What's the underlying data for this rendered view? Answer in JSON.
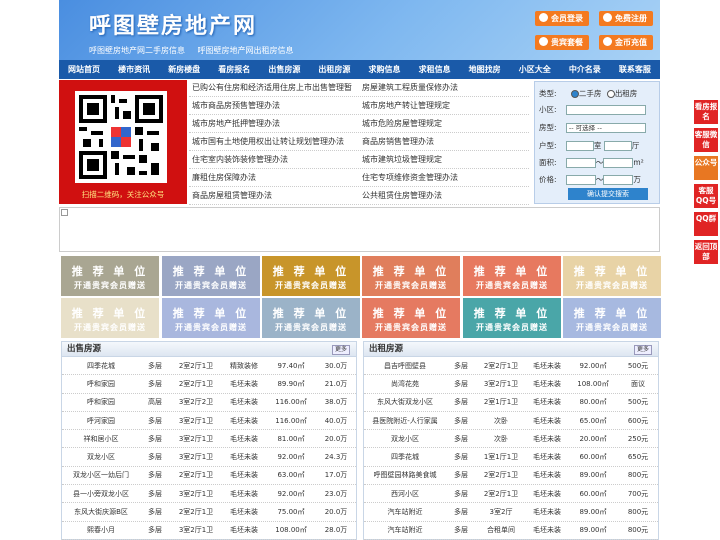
{
  "header": {
    "title": "呼图壁房地产网",
    "sub_links": [
      "呼图壁房地产网二手房信息",
      "呼图壁房地产网出租房信息"
    ],
    "buttons": [
      {
        "label": "会员登录"
      },
      {
        "label": "免费注册"
      },
      {
        "label": "贵宾套餐"
      },
      {
        "label": "金币充值"
      }
    ]
  },
  "nav": [
    "网站首页",
    "楼市资讯",
    "新房楼盘",
    "看房报名",
    "出售房源",
    "出租房源",
    "求购信息",
    "求租信息",
    "地图找房",
    "小区大全",
    "中介名录",
    "联系客服"
  ],
  "qr": {
    "caption": "扫描二维码，关注公众号"
  },
  "links": [
    [
      "已购公有住房和经济适用住房上市出售管理暂",
      "房屋建筑工程质量保修办法"
    ],
    [
      "城市商品房预售管理办法",
      "城市房地产转让管理规定"
    ],
    [
      "城市房地产抵押管理办法",
      "城市危险房屋管理规定"
    ],
    [
      "城市国有土地使用权出让转让规划管理办法",
      "商品房销售管理办法"
    ],
    [
      "住宅室内装饰装修管理办法",
      "城市建筑垃圾管理规定"
    ],
    [
      "廉租住房保障办法",
      "住宅专项维修资金管理办法"
    ],
    [
      "商品房屋租赁管理办法",
      "公共租赁住房管理办法"
    ]
  ],
  "search": {
    "type_label": "类型:",
    "opt1": "二手房",
    "opt2": "出租房",
    "community_label": "小区:",
    "house_label": "房型:",
    "house_value": "-- 可选择 --",
    "layout_label": "户型:",
    "room": "室",
    "hall": "厅",
    "area_label": "面积:",
    "area_unit": "m²",
    "price_label": "价格:",
    "price_unit": "万",
    "submit": "确认提交搜索"
  },
  "tiles": {
    "line1": "推 荐 单 位",
    "line2": "开通贵宾会员赠送",
    "colors": [
      "#a9a692",
      "#9aa6c4",
      "#c8952a",
      "#e07e5c",
      "#e7795f",
      "#e8d3a6",
      "#e8e0c9",
      "#a9b7de",
      "#9bb3c8",
      "#e57a61",
      "#4aa6a8",
      "#a7b9e0"
    ]
  },
  "sale": {
    "title": "出售房源",
    "more": "更多",
    "rows": [
      [
        "四季花城",
        "多层",
        "2室2厅1卫",
        "精致装修",
        "97.40㎡",
        "30.0万"
      ],
      [
        "呼和家园",
        "多层",
        "2室2厅1卫",
        "毛坯未装",
        "89.90㎡",
        "21.0万"
      ],
      [
        "呼和家园",
        "高层",
        "3室2厅2卫",
        "毛坯未装",
        "116.00㎡",
        "38.0万"
      ],
      [
        "呼河家园",
        "多层",
        "3室2厅1卫",
        "毛坯未装",
        "116.00㎡",
        "40.0万"
      ],
      [
        "祥和居小区",
        "多层",
        "3室2厅1卫",
        "毛坯未装",
        "81.00㎡",
        "20.0万"
      ],
      [
        "双龙小区",
        "多层",
        "3室2厅1卫",
        "毛坯未装",
        "92.00㎡",
        "24.3万"
      ],
      [
        "双龙小区一幼后门",
        "多层",
        "2室2厅1卫",
        "毛坯未装",
        "63.00㎡",
        "17.0万"
      ],
      [
        "县一小旁双龙小区",
        "多层",
        "3室2厅1卫",
        "毛坯未装",
        "92.00㎡",
        "23.0万"
      ],
      [
        "东风大街庆源B区",
        "多层",
        "2室2厅1卫",
        "毛坯未装",
        "75.00㎡",
        "20.0万"
      ],
      [
        "熙春小月",
        "多层",
        "3室2厅1卫",
        "毛坯未装",
        "108.00㎡",
        "28.0万"
      ]
    ]
  },
  "rent": {
    "title": "出租房源",
    "more": "更多",
    "rows": [
      [
        "昌吉呼图壁县",
        "多层",
        "2室2厅1卫",
        "毛坯未装",
        "92.00㎡",
        "500元"
      ],
      [
        "尚湾花苑",
        "多层",
        "3室2厅1卫",
        "毛坯未装",
        "108.00㎡",
        "面议"
      ],
      [
        "东风大街双龙小区",
        "多层",
        "2室1厅1卫",
        "毛坯未装",
        "80.00㎡",
        "500元"
      ],
      [
        "县医院附近-人行家属",
        "多层",
        "次卧",
        "毛坯未装",
        "65.00㎡",
        "600元"
      ],
      [
        "双龙小区",
        "多层",
        "次卧",
        "毛坯未装",
        "20.00㎡",
        "250元"
      ],
      [
        "四季花城",
        "多层",
        "1室1厅1卫",
        "毛坯未装",
        "60.00㎡",
        "650元"
      ],
      [
        "呼图壁园林路美食城",
        "多层",
        "2室2厅1卫",
        "毛坯未装",
        "89.00㎡",
        "800元"
      ],
      [
        "西河小区",
        "多层",
        "2室2厅1卫",
        "毛坯未装",
        "60.00㎡",
        "700元"
      ],
      [
        "汽车站附近",
        "多层",
        "3室2厅",
        "毛坯未装",
        "89.00㎡",
        "800元"
      ],
      [
        "汽车站附近",
        "多层",
        "合租单间",
        "毛坯未装",
        "89.00㎡",
        "800元"
      ]
    ]
  },
  "side": [
    "看房报名",
    "客服微信",
    "公众号",
    "客服QQ号",
    "QQ群",
    "返回顶部"
  ]
}
